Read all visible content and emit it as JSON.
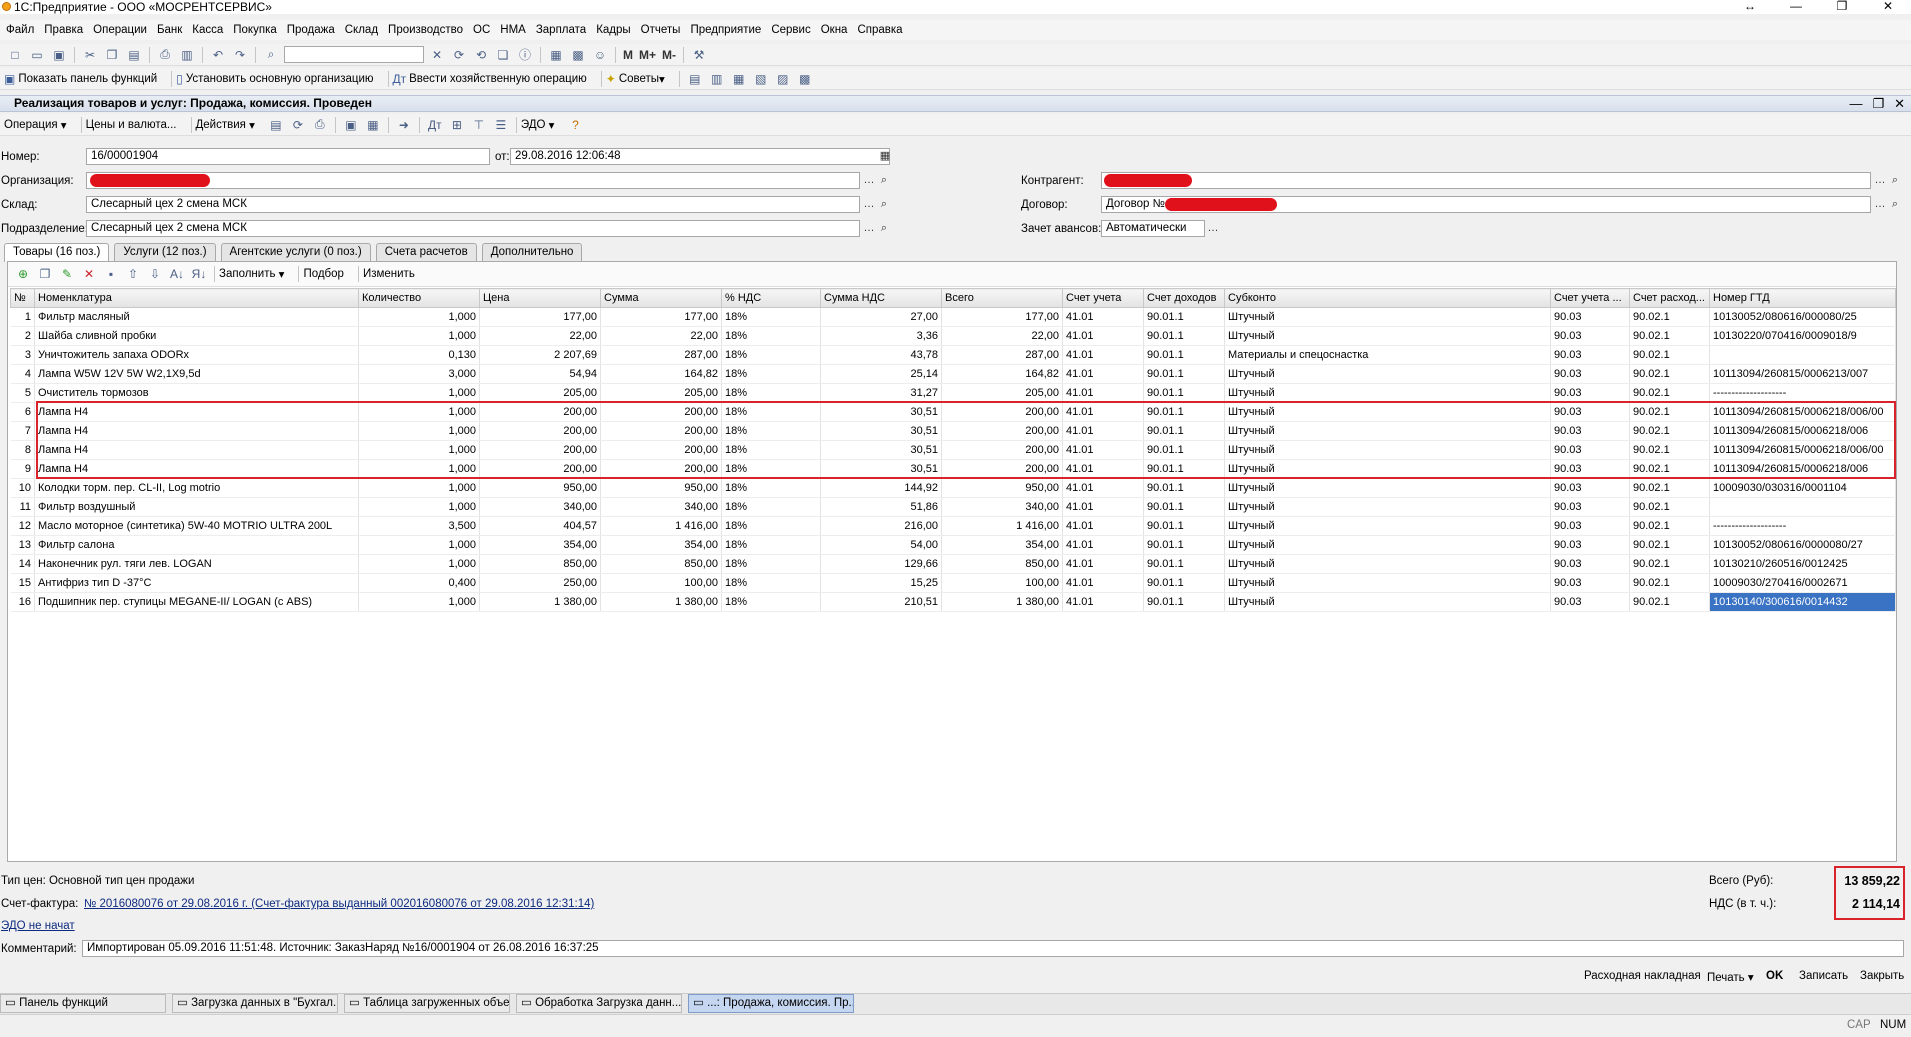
{
  "window": {
    "title": "1С:Предприятие - ООО «МОСРЕНТСЕРВИС»"
  },
  "menu": [
    "Файл",
    "Правка",
    "Операции",
    "Банк",
    "Касса",
    "Покупка",
    "Продажа",
    "Склад",
    "Производство",
    "ОС",
    "НМА",
    "Зарплата",
    "Кадры",
    "Отчеты",
    "Предприятие",
    "Сервис",
    "Окна",
    "Справка"
  ],
  "toolbar2": {
    "show_panel": "Показать панель функций",
    "set_org": "Установить основную организацию",
    "enter_op": "Ввести хозяйственную операцию",
    "advice": "Советы"
  },
  "document": {
    "title": "Реализация товаров и услуг: Продажа, комиссия. Проведен",
    "toolbar": {
      "operation": "Операция",
      "prices": "Цены и валюта...",
      "actions": "Действия",
      "edo": "ЭДО"
    },
    "fields": {
      "number_label": "Номер:",
      "number": "16/00001904",
      "date_label": "от:",
      "date": "29.08.2016 12:06:48",
      "org_label": "Организация:",
      "warehouse_label": "Склад:",
      "warehouse": "Слесарный цех 2 смена МСК",
      "division_label": "Подразделение:",
      "division": "Слесарный цех 2 смена МСК",
      "counterparty_label": "Контрагент:",
      "contract_label": "Договор:",
      "contract": "Договор №",
      "advances_label": "Зачет авансов:",
      "advances": "Автоматически"
    },
    "tabs": [
      "Товары (16 поз.)",
      "Услуги (12 поз.)",
      "Агентские услуги (0 поз.)",
      "Счета расчетов",
      "Дополнительно"
    ],
    "grid_toolbar": {
      "fill": "Заполнить",
      "select": "Подбор",
      "change": "Изменить"
    },
    "columns": [
      "№",
      "Номенклатура",
      "Количество",
      "Цена",
      "Сумма",
      "% НДС",
      "Сумма НДС",
      "Всего",
      "Счет учета",
      "Счет доходов",
      "Субконто",
      "Счет учета ...",
      "Счет расход...",
      "Номер ГТД"
    ],
    "rows": [
      [
        "1",
        "Фильтр масляный",
        "1,000",
        "177,00",
        "177,00",
        "18%",
        "27,00",
        "177,00",
        "41.01",
        "90.01.1",
        "Штучный",
        "90.03",
        "90.02.1",
        "10130052/080616/000080/25"
      ],
      [
        "2",
        "Шайба сливной пробки",
        "1,000",
        "22,00",
        "22,00",
        "18%",
        "3,36",
        "22,00",
        "41.01",
        "90.01.1",
        "Штучный",
        "90.03",
        "90.02.1",
        "10130220/070416/0009018/9"
      ],
      [
        "3",
        "Уничтожитель запаха ODORx",
        "0,130",
        "2 207,69",
        "287,00",
        "18%",
        "43,78",
        "287,00",
        "41.01",
        "90.01.1",
        "Материалы и спецоснастка",
        "90.03",
        "90.02.1",
        ""
      ],
      [
        "4",
        "Лампа W5W 12V 5W W2,1X9,5d",
        "3,000",
        "54,94",
        "164,82",
        "18%",
        "25,14",
        "164,82",
        "41.01",
        "90.01.1",
        "Штучный",
        "90.03",
        "90.02.1",
        "10113094/260815/0006213/007"
      ],
      [
        "5",
        "Очиститель тормозов",
        "1,000",
        "205,00",
        "205,00",
        "18%",
        "31,27",
        "205,00",
        "41.01",
        "90.01.1",
        "Штучный",
        "90.03",
        "90.02.1",
        "--------------------"
      ],
      [
        "6",
        "Лампа H4",
        "1,000",
        "200,00",
        "200,00",
        "18%",
        "30,51",
        "200,00",
        "41.01",
        "90.01.1",
        "Штучный",
        "90.03",
        "90.02.1",
        "10113094/260815/0006218/006/00"
      ],
      [
        "7",
        "Лампа H4",
        "1,000",
        "200,00",
        "200,00",
        "18%",
        "30,51",
        "200,00",
        "41.01",
        "90.01.1",
        "Штучный",
        "90.03",
        "90.02.1",
        "10113094/260815/0006218/006"
      ],
      [
        "8",
        "Лампа H4",
        "1,000",
        "200,00",
        "200,00",
        "18%",
        "30,51",
        "200,00",
        "41.01",
        "90.01.1",
        "Штучный",
        "90.03",
        "90.02.1",
        "10113094/260815/0006218/006/00"
      ],
      [
        "9",
        "Лампа H4",
        "1,000",
        "200,00",
        "200,00",
        "18%",
        "30,51",
        "200,00",
        "41.01",
        "90.01.1",
        "Штучный",
        "90.03",
        "90.02.1",
        "10113094/260815/0006218/006"
      ],
      [
        "10",
        "Колодки торм. пер. CL-II, Log motrio",
        "1,000",
        "950,00",
        "950,00",
        "18%",
        "144,92",
        "950,00",
        "41.01",
        "90.01.1",
        "Штучный",
        "90.03",
        "90.02.1",
        "10009030/030316/0001104"
      ],
      [
        "11",
        "Фильтр воздушный",
        "1,000",
        "340,00",
        "340,00",
        "18%",
        "51,86",
        "340,00",
        "41.01",
        "90.01.1",
        "Штучный",
        "90.03",
        "90.02.1",
        ""
      ],
      [
        "12",
        "Масло моторное (синтетика) 5W-40 MOTRIO ULTRA 200L",
        "3,500",
        "404,57",
        "1 416,00",
        "18%",
        "216,00",
        "1 416,00",
        "41.01",
        "90.01.1",
        "Штучный",
        "90.03",
        "90.02.1",
        "--------------------"
      ],
      [
        "13",
        "Фильтр салона",
        "1,000",
        "354,00",
        "354,00",
        "18%",
        "54,00",
        "354,00",
        "41.01",
        "90.01.1",
        "Штучный",
        "90.03",
        "90.02.1",
        "10130052/080616/0000080/27"
      ],
      [
        "14",
        "Наконечник рул. тяги лев. LOGAN",
        "1,000",
        "850,00",
        "850,00",
        "18%",
        "129,66",
        "850,00",
        "41.01",
        "90.01.1",
        "Штучный",
        "90.03",
        "90.02.1",
        "10130210/260516/0012425"
      ],
      [
        "15",
        "Антифриз тип D -37°C",
        "0,400",
        "250,00",
        "100,00",
        "18%",
        "15,25",
        "100,00",
        "41.01",
        "90.01.1",
        "Штучный",
        "90.03",
        "90.02.1",
        "10009030/270416/0002671"
      ],
      [
        "16",
        "Подшипник пер. ступицы MEGANE-II/ LOGAN (с ABS)",
        "1,000",
        "1 380,00",
        "1 380,00",
        "18%",
        "210,51",
        "1 380,00",
        "41.01",
        "90.01.1",
        "Штучный",
        "90.03",
        "90.02.1",
        "10130140/300616/0014432"
      ]
    ],
    "footer": {
      "price_type": "Тип цен: Основной тип цен продажи",
      "invoice_label": "Счет-фактура:",
      "invoice_link": "№ 2016080076 от 29.08.2016 г. (Счет-фактура выданный 002016080076 от 29.08.2016 12:31:14)",
      "edo_status": "ЭДО не начат",
      "total_label": "Всего (Руб):",
      "total": "13 859,22",
      "vat_label": "НДС (в т. ч.):",
      "vat": "2 114,14",
      "comment_label": "Комментарий:",
      "comment": "Импортирован 05.09.2016 11:51:48. Источник: ЗаказНаряд №16/0001904 от 26.08.2016 16:37:25"
    },
    "buttons": {
      "invoice": "Расходная накладная",
      "print": "Печать",
      "ok": "OK",
      "save": "Записать",
      "close": "Закрыть"
    }
  },
  "taskbar": [
    "Панель функций",
    "Загрузка данных в \"Бухгал...",
    "Таблица загруженных объе...",
    "Обработка  Загрузка данн...",
    "...: Продажа, комиссия. Пр..."
  ],
  "status": {
    "cap": "CAP",
    "num": "NUM"
  },
  "colors": {
    "highlight_red": "#d9222a",
    "selection": "#3a72c4"
  }
}
